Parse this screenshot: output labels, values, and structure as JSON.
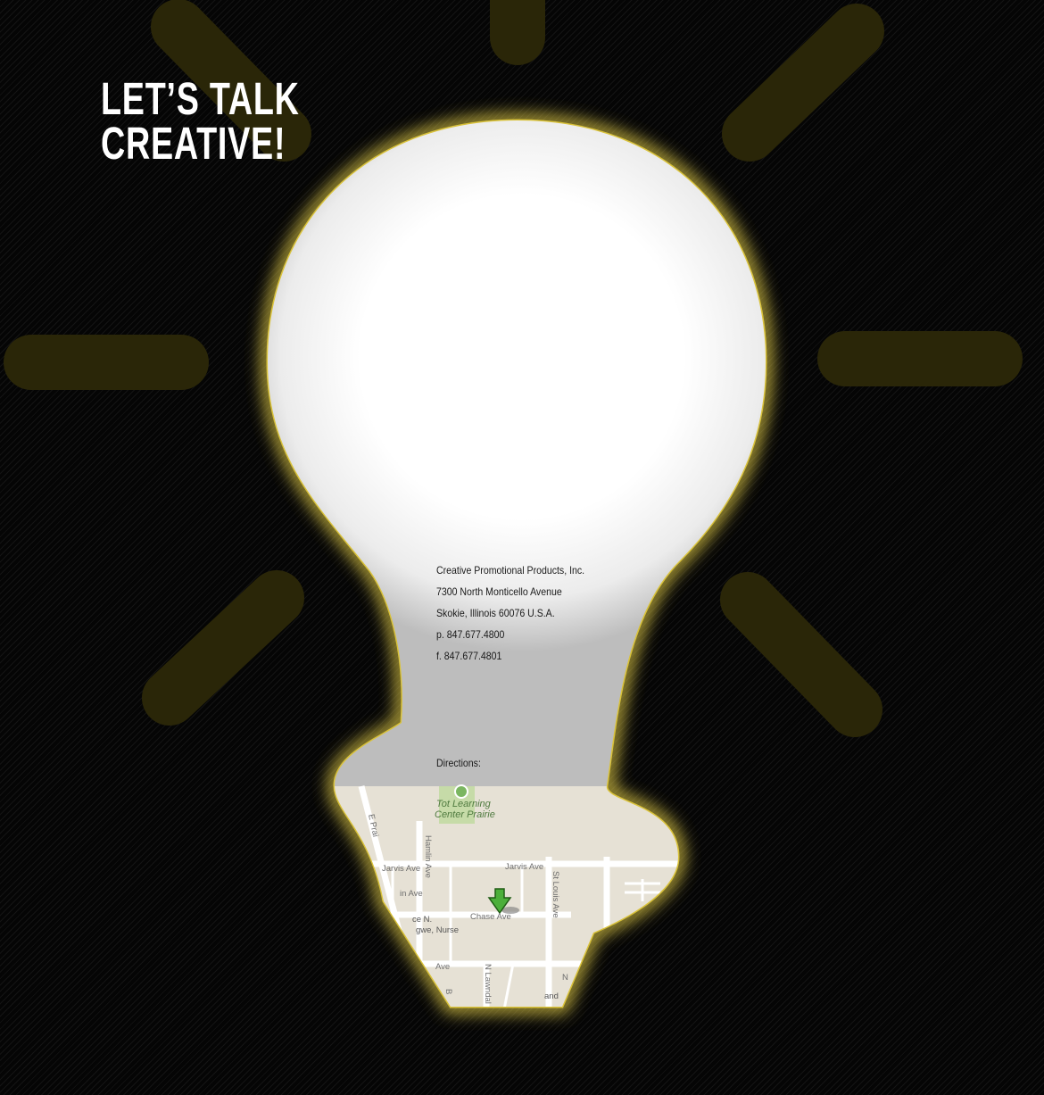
{
  "headline": {
    "line1": "LET’S TALK",
    "line2": "CREATIVE!"
  },
  "contact": {
    "company": "Creative Promotional Products, Inc.",
    "street": "7300 North Monticello Avenue",
    "city": "Skokie, Illinois 60076 U.S.A.",
    "phone": "p. 847.677.4800",
    "fax": "f. 847.677.4801"
  },
  "directions": {
    "label": "Directions:"
  },
  "map": {
    "poi_name_line1": "Tot Learning",
    "poi_name_line2": "Center Prairie",
    "streets": {
      "jarvis_east": "Jarvis Ave",
      "jarvis_west": "Jarvis Ave",
      "chase": "Chase Ave",
      "chase_west": "in Ave",
      "hamlin": "Hamlin Ave",
      "st_louis": "St Louis Ave",
      "prairie": "E Prai",
      "lawndale": "N Lawndal",
      "touhy_fragment": "Ave",
      "b_fragment": "B",
      "n_fragment": "N"
    },
    "business_line1": "ce N.",
    "business_line2": "gwe, Nurse",
    "fragment_and": "and"
  },
  "colors": {
    "background": "#050505",
    "glow": "#e8d24a",
    "ray": "#2a2608",
    "bulb": "#ffffff",
    "map_land": "#e6e1d5",
    "marker": "#4caf3a"
  }
}
